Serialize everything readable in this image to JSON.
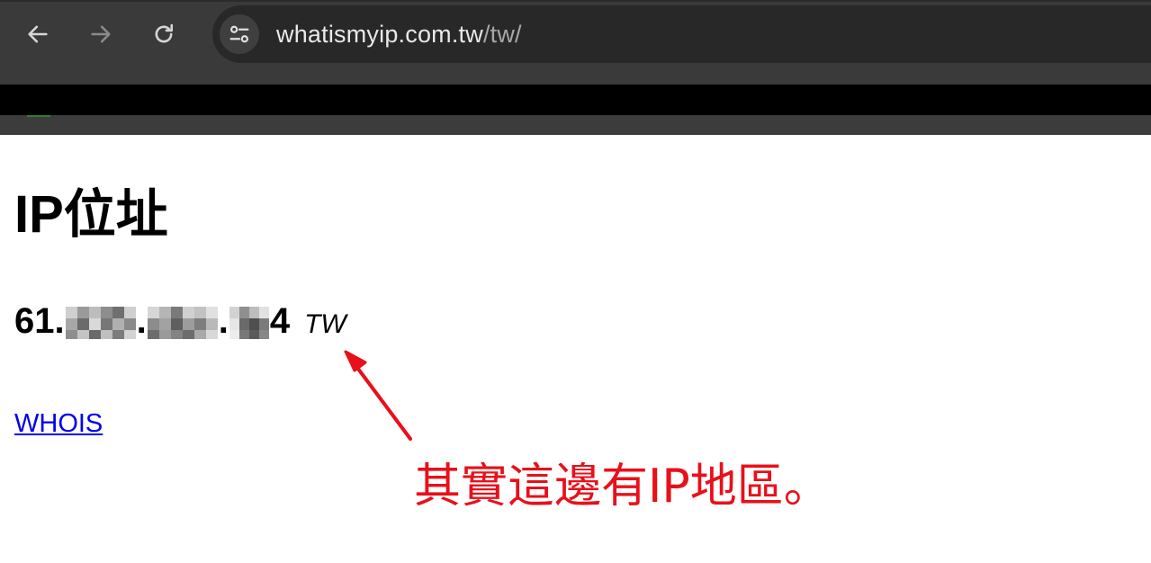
{
  "browser": {
    "url_host": "whatismyip.com.tw",
    "url_path": "/tw/",
    "back_icon": "arrow-left-icon",
    "forward_icon": "arrow-right-icon",
    "reload_icon": "reload-icon",
    "site_info_icon": "tune-icon"
  },
  "page": {
    "title": "IP位址",
    "ip_prefix": "61.",
    "ip_dot1": ".",
    "ip_dot2": ".",
    "ip_suffix": "4",
    "country": "TW",
    "whois_link": "WHOIS",
    "link_color": "#0000ee"
  },
  "annotation": {
    "text": "其實這邊有IP地區。",
    "color": "#e8101a"
  }
}
